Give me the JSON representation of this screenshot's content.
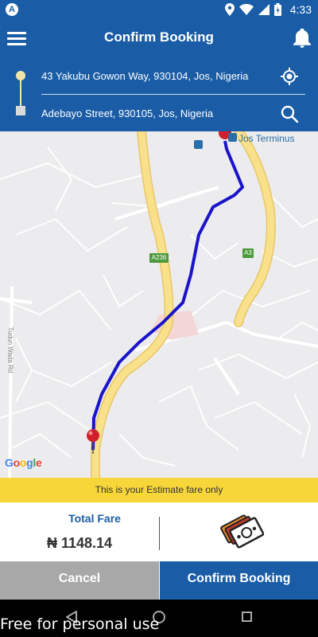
{
  "status_bar": {
    "app_badge": "A",
    "time": "4:33",
    "icons": [
      "location-icon",
      "wifi-icon",
      "signal-icon",
      "battery-icon"
    ]
  },
  "app_bar": {
    "title": "Confirm Booking",
    "menu_icon": "hamburger-menu-icon",
    "notification_icon": "bell-icon"
  },
  "addresses": {
    "pickup": "43 Yakubu Gowon Way, 930104, Jos, Nigeria",
    "dropoff": "Adebayo Street, 930105, Jos, Nigeria",
    "pickup_action_icon": "my-location-icon",
    "dropoff_action_icon": "search-icon"
  },
  "map": {
    "landmark": "Jos Terminus",
    "road_labels": [
      "A236",
      "A3"
    ],
    "street_label": "Tudun Wada Rd",
    "attribution": "Google",
    "route_color": "#1a14c8",
    "major_road_color": "#f9e08b"
  },
  "estimate_notice": "This is your Estimate fare only",
  "fare": {
    "label": "Total Fare",
    "value": "₦ 1148.14",
    "payment_icon": "cash-icon"
  },
  "actions": {
    "cancel_label": "Cancel",
    "confirm_label": "Confirm Booking"
  },
  "nav_bar": {
    "watermark": "Free for personal use"
  },
  "colors": {
    "primary": "#1a5da6",
    "accent_yellow": "#f7d63a",
    "cancel_gray": "#a8a8a8"
  }
}
